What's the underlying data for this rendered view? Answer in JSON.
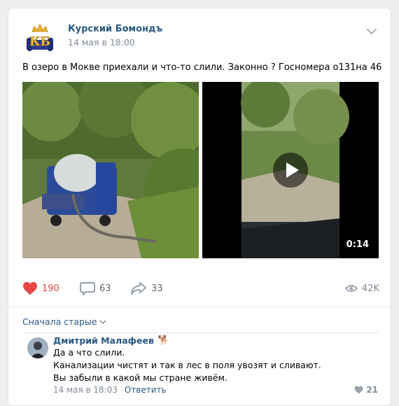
{
  "post": {
    "author": "Курский Бомондъ",
    "date": "14 мая в 18:00",
    "text": "В озеро в Мокве приехали и что-то слили. Законно ? Госномера о131на 46",
    "video_duration": "0:14"
  },
  "actions": {
    "likes": "190",
    "comments": "63",
    "shares": "33",
    "views": "42K"
  },
  "comments": {
    "sort_label": "Сначала старые",
    "items": [
      {
        "author": "Дмитрий Малафеев",
        "badge": "🐕",
        "lines": [
          "Да а что слили.",
          "Канализации чистят и так в лес в поля увозят и сливают.",
          "Вы забыли в какой мы стране живём."
        ],
        "date": "14 мая в 18:03",
        "reply_label": "Ответить",
        "likes": "21"
      }
    ]
  },
  "colors": {
    "link": "#2a5885",
    "like_active": "#e64646",
    "meta": "#818c99"
  }
}
